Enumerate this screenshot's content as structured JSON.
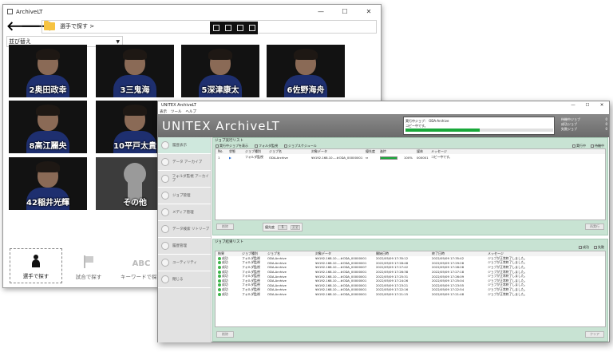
{
  "colors": {
    "accent_green": "#19a83a",
    "panel_bg": "#c8e3d3",
    "banner_bg": "#7a7a7a",
    "jersey_blue": "#1e2f6f"
  },
  "back_window": {
    "title": "ArchiveLT",
    "controls": [
      "—",
      "☐",
      "✕"
    ],
    "back_arrow": "🡐",
    "forward_arrow": "🡒",
    "breadcrumb": "選手で探す >",
    "sort_label": "並び替え",
    "players": [
      {
        "name": "2奥田政幸"
      },
      {
        "name": "3三鬼海"
      },
      {
        "name": "5深津康太"
      },
      {
        "name": "6佐野海舟"
      },
      {
        "name": "8高江麗央"
      },
      {
        "name": "10平戸太貴"
      },
      {
        "name": "42稲井光輝"
      },
      {
        "name": "その他"
      }
    ],
    "bottom_nav": [
      {
        "label": "選手で探す",
        "icon": "person-icon"
      },
      {
        "label": "試合で探す",
        "icon": "flag-icon"
      },
      {
        "label": "キーワードで探す",
        "icon": "abc-icon",
        "glyph": "ABC"
      }
    ]
  },
  "front_window": {
    "title": "UNITEX ArchiveLT",
    "controls": [
      "—",
      "☐",
      "✕"
    ],
    "menu": [
      "表示",
      "ツール",
      "ヘルプ"
    ],
    "brand": "UNITEX ArchiveLT",
    "status": {
      "line1": "実行中ジョブ： ODA-Archive",
      "line2": "コピー中です。",
      "progress": 0.5
    },
    "counters": [
      {
        "label": "待機中ジョブ",
        "value": "0"
      },
      {
        "label": "成功ジョブ",
        "value": "0"
      },
      {
        "label": "失敗ジョブ",
        "value": "0"
      }
    ],
    "sidebar": [
      {
        "label": "履歴表示"
      },
      {
        "label": "データ アーカイブ"
      },
      {
        "label": "フォルダ監視 アーカイブ"
      },
      {
        "label": "ジョブ管理"
      },
      {
        "label": "メディア管理"
      },
      {
        "label": "データ検索 リトリーブ"
      },
      {
        "label": "履歴管理"
      },
      {
        "label": "ユーティリティ"
      },
      {
        "label": "閉じる"
      }
    ],
    "job_list": {
      "title": "ジョブ実行リスト",
      "filters": [
        "実行中ジョブを表示",
        "フォルダ監視",
        "ジョブスケジュール"
      ],
      "right_checks": [
        "実行中",
        "待機中"
      ],
      "columns": [
        "No.",
        "状態",
        "ジョブ種別",
        "ジョブ名",
        "対象データ",
        "優先度",
        "進捗",
        "",
        "媒体",
        "メッセージ"
      ],
      "rows": [
        {
          "no": "1",
          "state": "▶",
          "type": "フォルダ監視",
          "name": "ODA-Archive",
          "target": "¥¥192.168.10....#ODA_00000001",
          "priority": "⇔",
          "progress": 1.0,
          "percent": "100%",
          "media": "000001",
          "message": "コピー中です。"
        }
      ],
      "delete_btn": "削除",
      "priority_label": "優先度",
      "priority_value": "5",
      "change_btn": "変更",
      "right_btn": "再実行"
    },
    "history": {
      "title": "ジョブ結果リスト",
      "right_checks": [
        "成功",
        "失敗"
      ],
      "columns": [
        "結果",
        "ジョブ種別",
        "ジョブ名",
        "対象データ",
        "開始日時",
        "終了日時",
        "メッセージ"
      ],
      "rows": [
        {
          "result": "成功",
          "type": "フォルダ監視",
          "name": "ODA-Archive",
          "target": "¥¥192.168.10....#ODA_00000001",
          "start": "2022/05/09 17:35:12",
          "end": "2022/05/09 17:35:42",
          "msg": "ジョブが正常終了しました。"
        },
        {
          "result": "成功",
          "type": "フォルダ監視",
          "name": "ODA-Archive",
          "target": "¥¥192.168.10....#ODA_00000001",
          "start": "2022/05/09 17:28:48",
          "end": "2022/05/09 17:29:28",
          "msg": "ジョブが正常終了しました。"
        },
        {
          "result": "成功",
          "type": "フォルダ監視",
          "name": "ODA-Archive",
          "target": "¥¥192.168.10....#ODA_00000007",
          "start": "2022/05/09 17:27:42",
          "end": "2022/05/09 17:28:28",
          "msg": "ジョブが正常終了しました。"
        },
        {
          "result": "成功",
          "type": "フォルダ監視",
          "name": "ODA-Archive",
          "target": "¥¥192.168.10....#ODA_00000001",
          "start": "2022/05/09 17:26:38",
          "end": "2022/05/09 17:27:18",
          "msg": "ジョブが正常終了しました。"
        },
        {
          "result": "成功",
          "type": "フォルダ監視",
          "name": "ODA-Archive",
          "target": "¥¥192.168.10....#ODA_00000001",
          "start": "2022/05/09 17:25:31",
          "end": "2022/05/09 17:26:09",
          "msg": "ジョブが正常終了しました。"
        },
        {
          "result": "成功",
          "type": "フォルダ監視",
          "name": "ODA-Archive",
          "target": "¥¥192.168.10....#ODA_00000001",
          "start": "2022/05/09 17:24:26",
          "end": "2022/05/09 17:25:04",
          "msg": "ジョブが正常終了しました。"
        },
        {
          "result": "成功",
          "type": "フォルダ監視",
          "name": "ODA-Archive",
          "target": "¥¥192.168.10....#ODA_00000001",
          "start": "2022/05/09 17:23:21",
          "end": "2022/05/09 17:23:55",
          "msg": "ジョブが正常終了しました。"
        },
        {
          "result": "成功",
          "type": "フォルダ監視",
          "name": "ODA-Archive",
          "target": "¥¥192.168.10....#ODA_00000001",
          "start": "2022/05/09 17:22:16",
          "end": "2022/05/09 17:22:54",
          "msg": "ジョブが正常終了しました。"
        },
        {
          "result": "成功",
          "type": "フォルダ監視",
          "name": "ODA-Archive",
          "target": "¥¥192.168.10....#ODA_00000001",
          "start": "2022/05/09 17:21:15",
          "end": "2022/05/09 17:21:48",
          "msg": "ジョブが正常終了しました。"
        }
      ],
      "delete_btn": "削除",
      "right_btn": "クリア"
    }
  }
}
